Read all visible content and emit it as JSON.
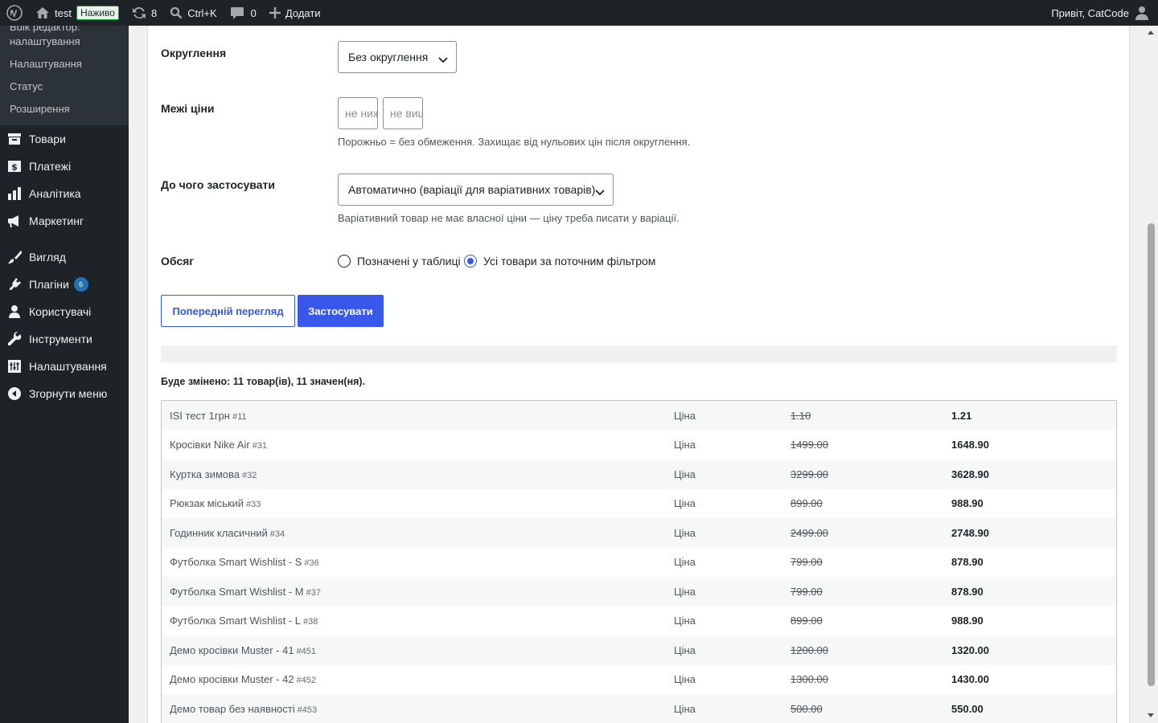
{
  "adminbar": {
    "site_name": "test",
    "live_badge": "Наживо",
    "updates_count": "8",
    "search_shortcut": "Ctrl+K",
    "comments_count": "0",
    "add_new": "Додати",
    "greeting": "Привіт, CatCode"
  },
  "sidebar": {
    "submenu": [
      "Bulk редактор: налаштування",
      "Налаштування",
      "Статус",
      "Розширення"
    ],
    "menu": [
      {
        "label": "Товари",
        "icon": "archive-icon"
      },
      {
        "label": "Платежі",
        "icon": "dollar-icon"
      },
      {
        "label": "Аналітика",
        "icon": "bar-chart-icon"
      },
      {
        "label": "Маркетинг",
        "icon": "megaphone-icon"
      },
      {
        "label": "Вигляд",
        "icon": "paintbrush-icon"
      },
      {
        "label": "Плагіни",
        "icon": "plugin-icon",
        "badge": "6"
      },
      {
        "label": "Користувачі",
        "icon": "user-icon"
      },
      {
        "label": "Інструменти",
        "icon": "wrench-icon"
      },
      {
        "label": "Налаштування",
        "icon": "settings-icon"
      },
      {
        "label": "Згорнути меню",
        "icon": "collapse-icon"
      }
    ]
  },
  "form": {
    "rounding": {
      "label": "Округлення",
      "value": "Без округлення"
    },
    "price_limits": {
      "label": "Межі ціни",
      "min_placeholder": "не нижче",
      "max_placeholder": "не вище",
      "hint": "Порожньо = без обмеження. Захищає від нульових цін після округлення."
    },
    "apply_to": {
      "label": "До чого застосувати",
      "value": "Автоматично (варіації для варіативних товарів)",
      "hint": "Варіативний товар не має власної ціни — ціну треба писати у варіації."
    },
    "scope": {
      "label": "Обсяг",
      "options": [
        "Позначені у таблиці",
        "Усі товари за поточним фільтром"
      ],
      "selected": 1
    },
    "preview_button": "Попередній перегляд",
    "apply_button": "Застосувати"
  },
  "summary": "Буде змінено: 11 товар(ів), 11 значен(ня).",
  "preview_table": {
    "rows": [
      {
        "name": "ISI тест 1грн",
        "id": "#11",
        "field": "Ціна",
        "old": "1.10",
        "new": "1.21"
      },
      {
        "name": "Кросівки Nike Air",
        "id": "#31",
        "field": "Ціна",
        "old": "1499.00",
        "new": "1648.90"
      },
      {
        "name": "Куртка зимова",
        "id": "#32",
        "field": "Ціна",
        "old": "3299.00",
        "new": "3628.90"
      },
      {
        "name": "Рюкзак міський",
        "id": "#33",
        "field": "Ціна",
        "old": "899.00",
        "new": "988.90"
      },
      {
        "name": "Годинник класичний",
        "id": "#34",
        "field": "Ціна",
        "old": "2499.00",
        "new": "2748.90"
      },
      {
        "name": "Футболка Smart Wishlist - S",
        "id": "#36",
        "field": "Ціна",
        "old": "799.00",
        "new": "878.90"
      },
      {
        "name": "Футболка Smart Wishlist - M",
        "id": "#37",
        "field": "Ціна",
        "old": "799.00",
        "new": "878.90"
      },
      {
        "name": "Футболка Smart Wishlist - L",
        "id": "#38",
        "field": "Ціна",
        "old": "899.00",
        "new": "988.90"
      },
      {
        "name": "Демо кросівки Muster - 41",
        "id": "#451",
        "field": "Ціна",
        "old": "1200.00",
        "new": "1320.00"
      },
      {
        "name": "Демо кросівки Muster - 42",
        "id": "#452",
        "field": "Ціна",
        "old": "1300.00",
        "new": "1430.00"
      },
      {
        "name": "Демо товар без наявності",
        "id": "#453",
        "field": "Ціна",
        "old": "500.00",
        "new": "550.00"
      }
    ]
  },
  "colors": {
    "accent": "#3858e9",
    "adminbar": "#1d2327",
    "live": "#00a32a"
  }
}
